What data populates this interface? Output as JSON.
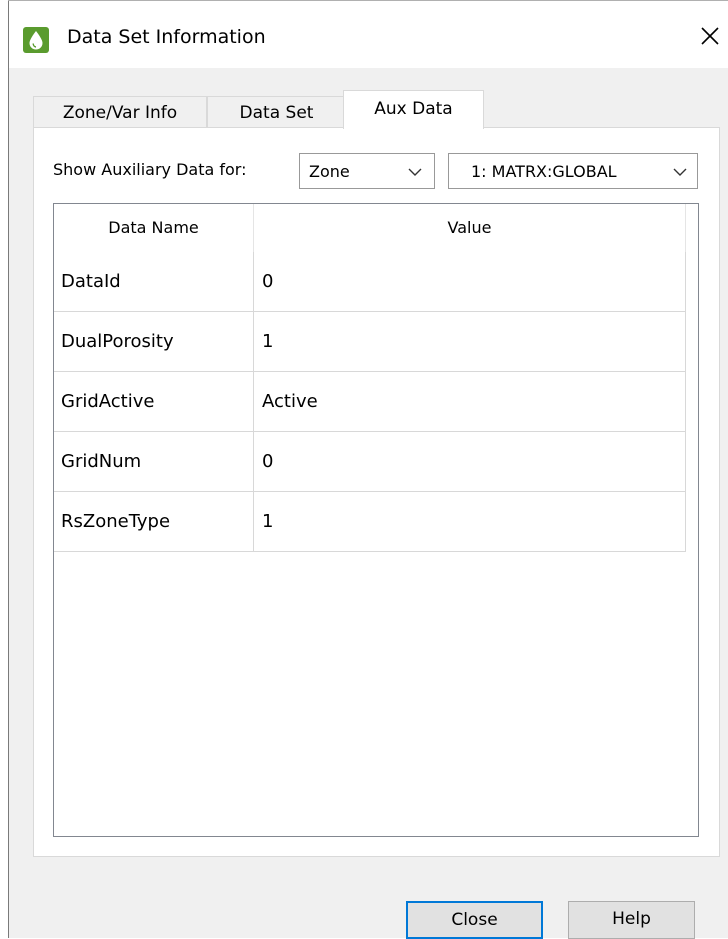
{
  "window": {
    "title": "Data Set Information",
    "close_symbol": "✕"
  },
  "tabs": [
    {
      "label": "Zone/Var Info",
      "active": false
    },
    {
      "label": "Data Set",
      "active": false
    },
    {
      "label": "Aux Data",
      "active": true
    }
  ],
  "aux": {
    "show_label": "Show Auxiliary Data for:",
    "scope_select": {
      "value": "Zone"
    },
    "zone_select": {
      "value": "1: MATRX:GLOBAL"
    }
  },
  "table": {
    "headers": [
      "Data Name",
      "Value"
    ],
    "rows": [
      {
        "name": "DataId",
        "value": "0"
      },
      {
        "name": "DualPorosity",
        "value": "1"
      },
      {
        "name": "GridActive",
        "value": "Active"
      },
      {
        "name": "GridNum",
        "value": "0"
      },
      {
        "name": "RsZoneType",
        "value": "1"
      }
    ]
  },
  "buttons": {
    "close_label": "Close",
    "help_label": "Help"
  },
  "colors": {
    "app_icon": "#5a9b2e",
    "default_button_border": "#0078d7",
    "dialog_background": "#f0f0f0"
  },
  "icons": {
    "app": "tecplot-drop-icon",
    "close": "close-icon",
    "dropdown": "chevron-down-icon"
  }
}
